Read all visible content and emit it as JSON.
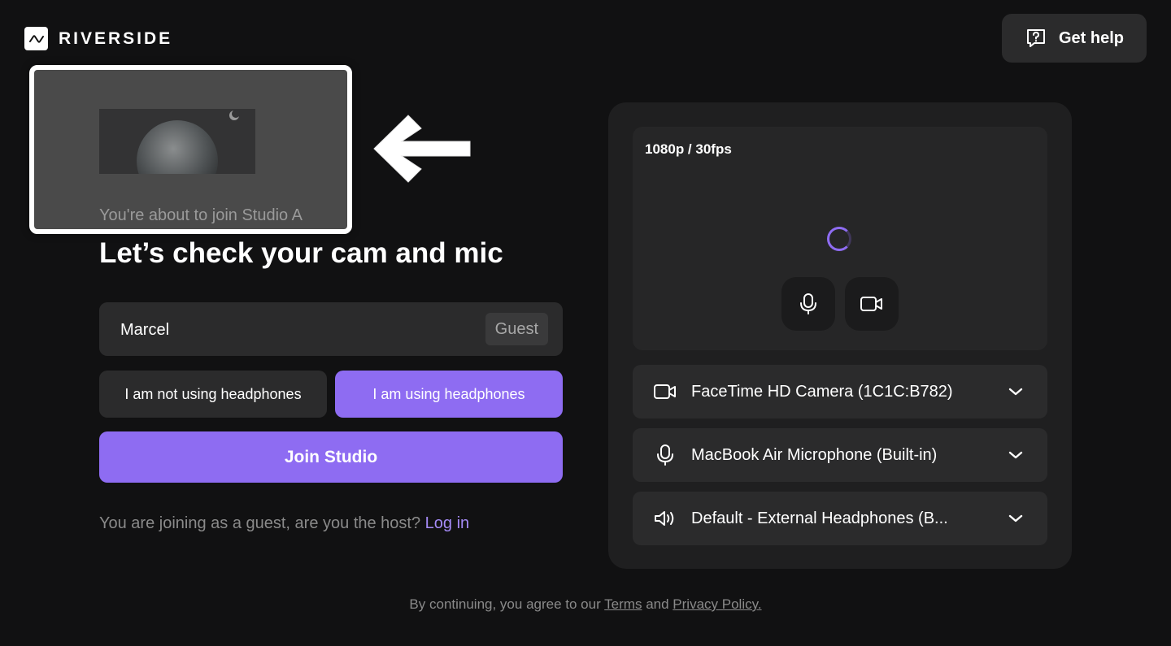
{
  "brand": {
    "name": "RIVERSIDE"
  },
  "help": {
    "label": "Get help"
  },
  "studio": {
    "caption": "You're about to join Studio A"
  },
  "headline": "Let’s check your cam and mic",
  "name_field": {
    "value": "Marcel",
    "badge": "Guest"
  },
  "headphones": {
    "not_using": "I am not using headphones",
    "using": "I am using headphones",
    "selected": "using"
  },
  "join": {
    "label": "Join Studio"
  },
  "guest_note": {
    "text": "You are joining as a guest, are you the host?",
    "link": "Log in"
  },
  "preview": {
    "resolution": "1080p / 30fps"
  },
  "devices": {
    "camera": "FaceTime HD Camera (1C1C:B782)",
    "microphone": "MacBook Air Microphone (Built-in)",
    "speaker": "Default - External Headphones (B..."
  },
  "footer": {
    "prefix": "By continuing, you agree to our",
    "terms": "Terms",
    "and": "and",
    "privacy": "Privacy Policy."
  },
  "colors": {
    "accent": "#8e6cf2",
    "background": "#111112",
    "surface": "#2b2b2c"
  }
}
